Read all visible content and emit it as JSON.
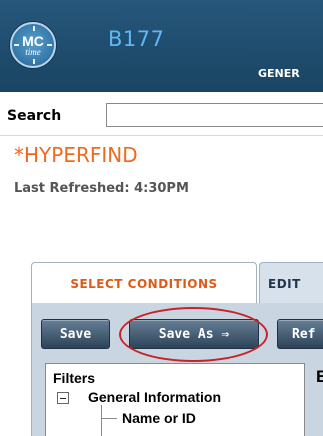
{
  "header": {
    "logo_text": "MC",
    "logo_subtext": "time",
    "app_title": "B177",
    "section_label": "GENER"
  },
  "search": {
    "label": "Search",
    "value": ""
  },
  "page": {
    "title": "*HYPERFIND",
    "last_refreshed": "Last Refreshed: 4:30PM"
  },
  "tabs": [
    {
      "label": "SELECT CONDITIONS",
      "active": true
    },
    {
      "label": "EDIT",
      "active": false
    }
  ],
  "toolbar": {
    "save_label": "Save",
    "save_as_label": "Save As ⇒",
    "refresh_label": "Ref"
  },
  "filters": {
    "title": "Filters",
    "group_label": "General Information",
    "item_label": "Name or ID",
    "right_panel_initial": "E"
  },
  "colors": {
    "header_bg": "#1e4d6e",
    "title_accent": "#5fb7f5",
    "hyperfind_orange": "#ee6a1e",
    "highlight_red": "#c8232b"
  }
}
